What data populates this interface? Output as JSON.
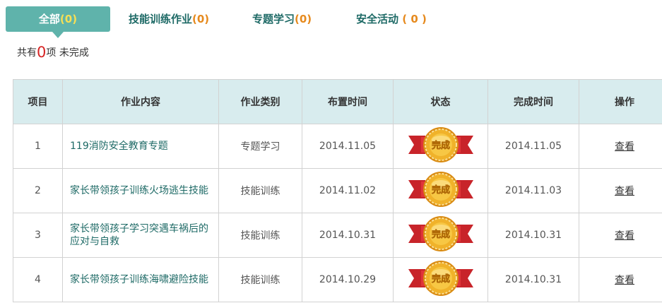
{
  "tabs": [
    {
      "label": "全部",
      "count": "(0)"
    },
    {
      "label": "技能训练作业",
      "count": "(0)"
    },
    {
      "label": "专题学习",
      "count": "(0)"
    },
    {
      "label": "安全活动",
      "count": "( 0 )"
    }
  ],
  "summary": {
    "prefix": "共有",
    "count": "0",
    "suffix": "项 未完成"
  },
  "table": {
    "headers": [
      "项目",
      "作业内容",
      "作业类别",
      "布置时间",
      "状态",
      "完成时间",
      "操作"
    ],
    "rows": [
      {
        "index": "1",
        "content": "119消防安全教育专题",
        "category": "专题学习",
        "assigned": "2014.11.05",
        "status": "完成",
        "completed": "2014.11.05",
        "action": "查看"
      },
      {
        "index": "2",
        "content": "家长带领孩子训练火场逃生技能",
        "category": "技能训练",
        "assigned": "2014.11.02",
        "status": "完成",
        "completed": "2014.11.03",
        "action": "查看"
      },
      {
        "index": "3",
        "content": "家长带领孩子学习突遇车祸后的应对与自救",
        "category": "技能训练",
        "assigned": "2014.10.31",
        "status": "完成",
        "completed": "2014.10.31",
        "action": "查看"
      },
      {
        "index": "4",
        "content": "家长带领孩子训练海啸避险技能",
        "category": "技能训练",
        "assigned": "2014.10.29",
        "status": "完成",
        "completed": "2014.10.31",
        "action": "查看"
      }
    ]
  },
  "colors": {
    "tab_active_bg": "#5fb3ab",
    "tab_text": "#1e6a66",
    "count_orange": "#e68a1e",
    "header_bg": "#d8ecee",
    "badge_gold": "#f0b22a",
    "badge_ribbon": "#c8242a"
  },
  "icons": {
    "status_badge": "completed-medal-icon"
  }
}
